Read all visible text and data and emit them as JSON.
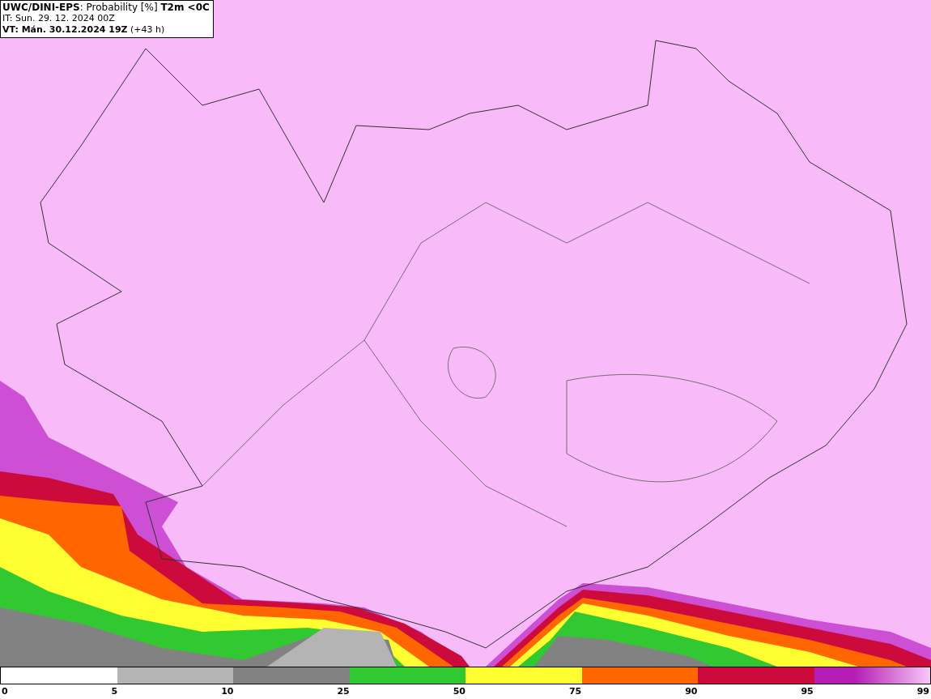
{
  "title_box": {
    "lines": [
      "**UWC/DINI-EPS**: Probability [%] **T2m <0C**",
      "IT: Sun. 29. 12. 2024 00Z",
      "**VT: Mán. 30.12.2024 19Z** (+43 h)"
    ]
  },
  "legend": {
    "segments": [
      {
        "color": "#b4b4b4"
      },
      {
        "color": "#828282"
      },
      {
        "color": "#32c832"
      },
      {
        "color": "#ffff32"
      },
      {
        "color": "#ff6600"
      },
      {
        "color": "#cc0a3c"
      },
      {
        "color": "#b41eb4"
      }
    ],
    "labels": [
      "0",
      "5",
      "10",
      "25",
      "50",
      "75",
      "90",
      "95",
      "99"
    ]
  }
}
